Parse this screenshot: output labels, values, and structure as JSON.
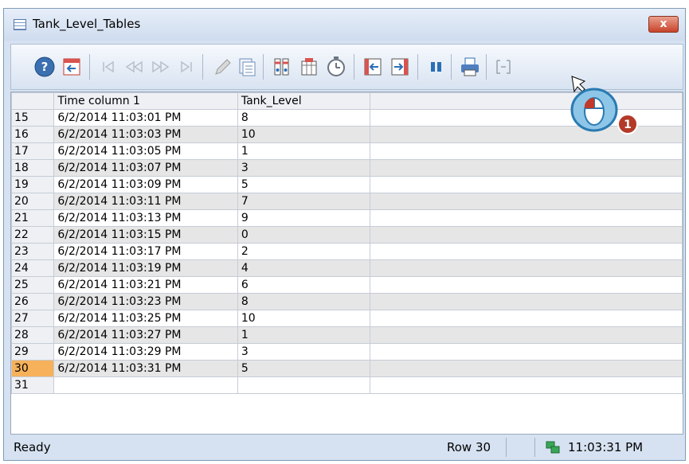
{
  "window": {
    "title": "Tank_Level_Tables",
    "close_label": "x"
  },
  "toolbar": {
    "buttons": [
      "help-icon",
      "config-dialog-icon",
      "first-record-icon",
      "previous-record-icon",
      "next-record-icon",
      "last-record-icon",
      "edit-icon",
      "copy-rows-icon",
      "select-columns-icon",
      "select-archive-icon",
      "time-range-icon",
      "previous-column-icon",
      "next-column-icon",
      "pause-icon",
      "print-icon",
      "export-icon"
    ]
  },
  "table": {
    "headers": [
      "",
      "Time column 1",
      "Tank_Level",
      ""
    ],
    "rows": [
      {
        "n": "15",
        "time": "6/2/2014 11:03:01 PM",
        "level": "8"
      },
      {
        "n": "16",
        "time": "6/2/2014 11:03:03 PM",
        "level": "10"
      },
      {
        "n": "17",
        "time": "6/2/2014 11:03:05 PM",
        "level": "1"
      },
      {
        "n": "18",
        "time": "6/2/2014 11:03:07 PM",
        "level": "3"
      },
      {
        "n": "19",
        "time": "6/2/2014 11:03:09 PM",
        "level": "5"
      },
      {
        "n": "20",
        "time": "6/2/2014 11:03:11 PM",
        "level": "7"
      },
      {
        "n": "21",
        "time": "6/2/2014 11:03:13 PM",
        "level": "9"
      },
      {
        "n": "22",
        "time": "6/2/2014 11:03:15 PM",
        "level": "0"
      },
      {
        "n": "23",
        "time": "6/2/2014 11:03:17 PM",
        "level": "2"
      },
      {
        "n": "24",
        "time": "6/2/2014 11:03:19 PM",
        "level": "4"
      },
      {
        "n": "25",
        "time": "6/2/2014 11:03:21 PM",
        "level": "6"
      },
      {
        "n": "26",
        "time": "6/2/2014 11:03:23 PM",
        "level": "8"
      },
      {
        "n": "27",
        "time": "6/2/2014 11:03:25 PM",
        "level": "10"
      },
      {
        "n": "28",
        "time": "6/2/2014 11:03:27 PM",
        "level": "1"
      },
      {
        "n": "29",
        "time": "6/2/2014 11:03:29 PM",
        "level": "3"
      },
      {
        "n": "30",
        "time": "6/2/2014 11:03:31 PM",
        "level": "5"
      },
      {
        "n": "31",
        "time": "",
        "level": ""
      }
    ],
    "selected_row": "30"
  },
  "statusbar": {
    "ready": "Ready",
    "row": "Row 30",
    "time": "11:03:31 PM"
  },
  "callout": {
    "step": "1"
  },
  "colors": {
    "selected_row_header": "#f6b15a",
    "alt_row": "#e6e6e6",
    "accent": "#1f5fa8"
  }
}
